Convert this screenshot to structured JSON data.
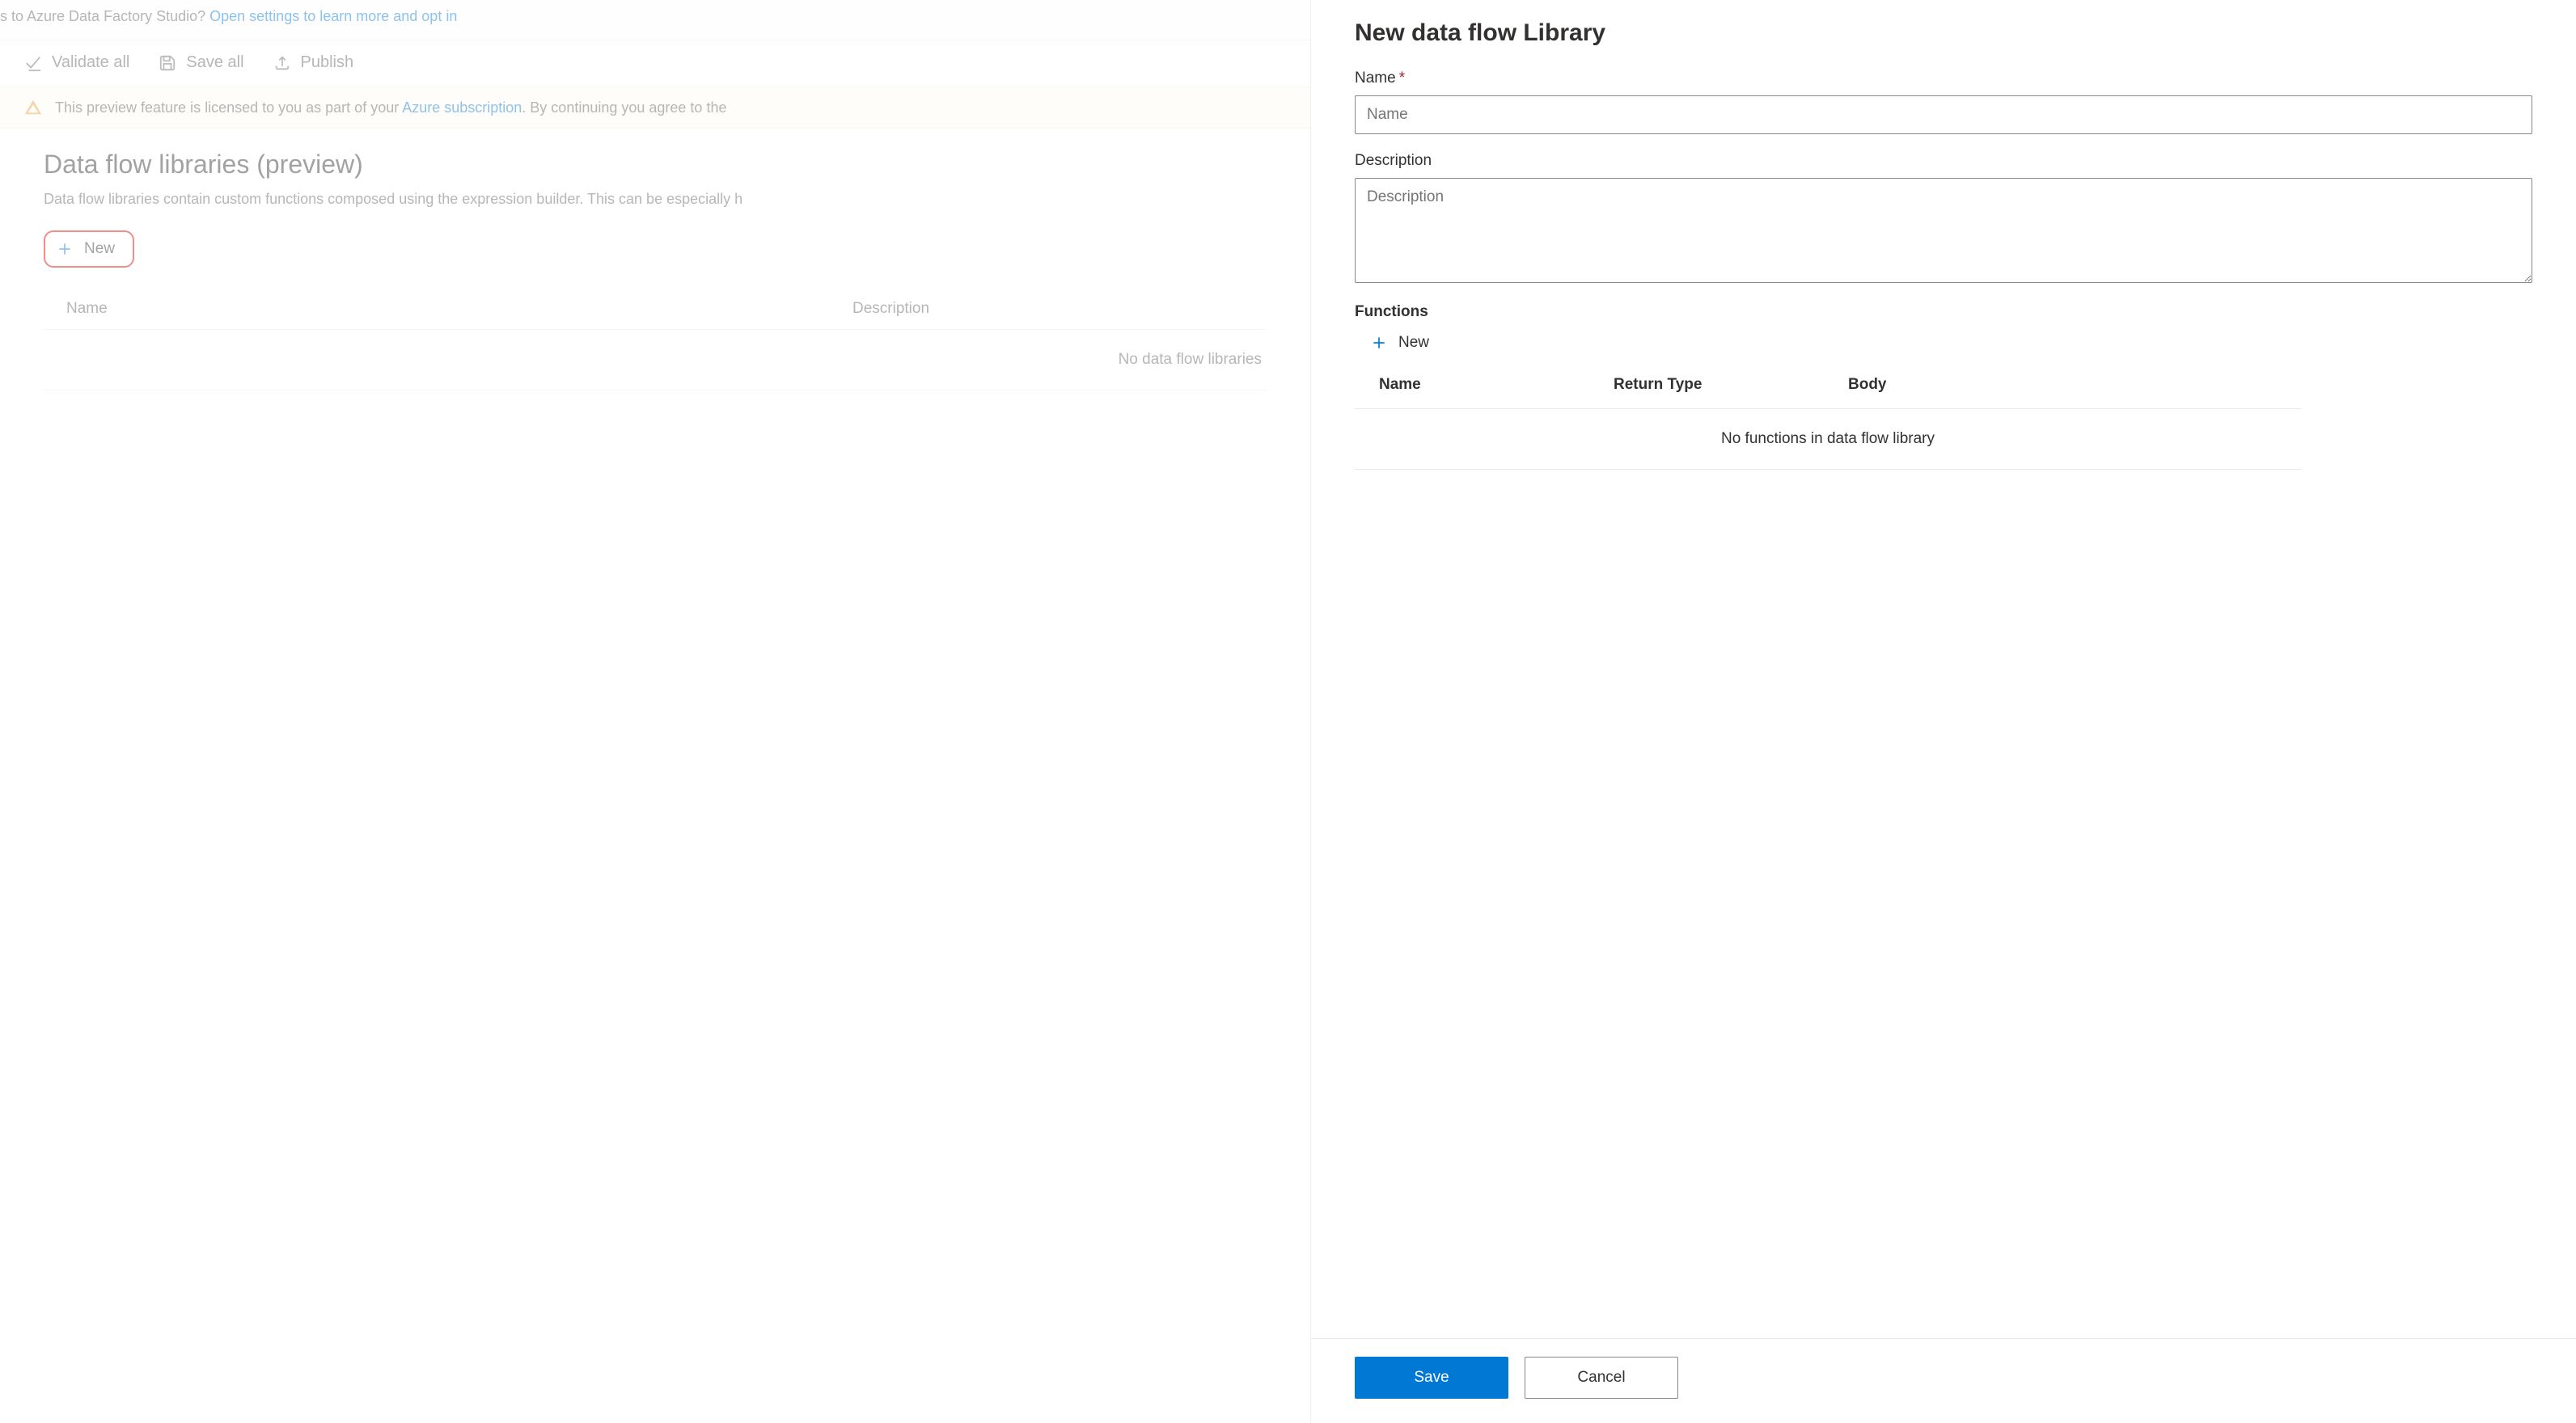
{
  "top_banner": {
    "prefix": "s to Azure Data Factory Studio? ",
    "link": "Open settings to learn more and opt in"
  },
  "toolbar": {
    "validate_all": "Validate all",
    "save_all": "Save all",
    "publish": "Publish"
  },
  "notice": {
    "prefix": "This preview feature is licensed to you as part of your ",
    "link": "Azure subscription",
    "suffix": ". By continuing you agree to the"
  },
  "page": {
    "title": "Data flow libraries (preview)",
    "subtitle": "Data flow libraries contain custom functions composed using the expression builder. This can be especially h",
    "new_button": "New",
    "columns": {
      "name": "Name",
      "description": "Description"
    },
    "empty": "No data flow libraries "
  },
  "panel": {
    "title": "New data flow Library",
    "name_label": "Name",
    "name_placeholder": "Name",
    "name_value": "",
    "description_label": "Description",
    "description_placeholder": "Description",
    "description_value": "",
    "functions_label": "Functions",
    "new_function": "New",
    "func_columns": {
      "name": "Name",
      "return_type": "Return Type",
      "body": "Body"
    },
    "func_empty": "No functions in data flow library",
    "save": "Save",
    "cancel": "Cancel"
  }
}
